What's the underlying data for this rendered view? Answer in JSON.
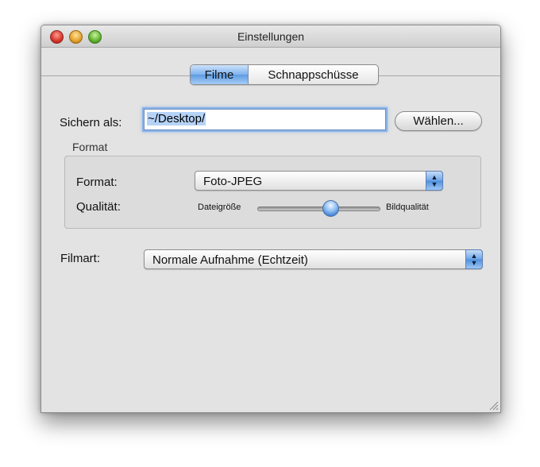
{
  "window": {
    "title": "Einstellungen"
  },
  "tabs": [
    {
      "label": "Filme",
      "selected": true
    },
    {
      "label": "Schnappschüsse",
      "selected": false
    }
  ],
  "save": {
    "label": "Sichern als:",
    "value": "~/Desktop/",
    "choose_button": "Wählen..."
  },
  "format_group": {
    "title": "Format",
    "format_label": "Format:",
    "format_value": "Foto-JPEG",
    "quality_label": "Qualität:",
    "quality_min_label": "Dateigröße",
    "quality_max_label": "Bildqualität",
    "quality_value": 0.6
  },
  "movie_type": {
    "label": "Filmart:",
    "value": "Normale Aufnahme (Echtzeit)"
  },
  "icons": {
    "close": "close-traffic-light-icon",
    "minimize": "minimize-traffic-light-icon",
    "zoom": "zoom-traffic-light-icon",
    "popup": "up-down-chevron-icon",
    "resize": "resize-grip-icon"
  },
  "colors": {
    "window_bg": "#e3e3e3",
    "accent_blue": "#5d9be2",
    "focus_ring": "#87b2e8"
  }
}
